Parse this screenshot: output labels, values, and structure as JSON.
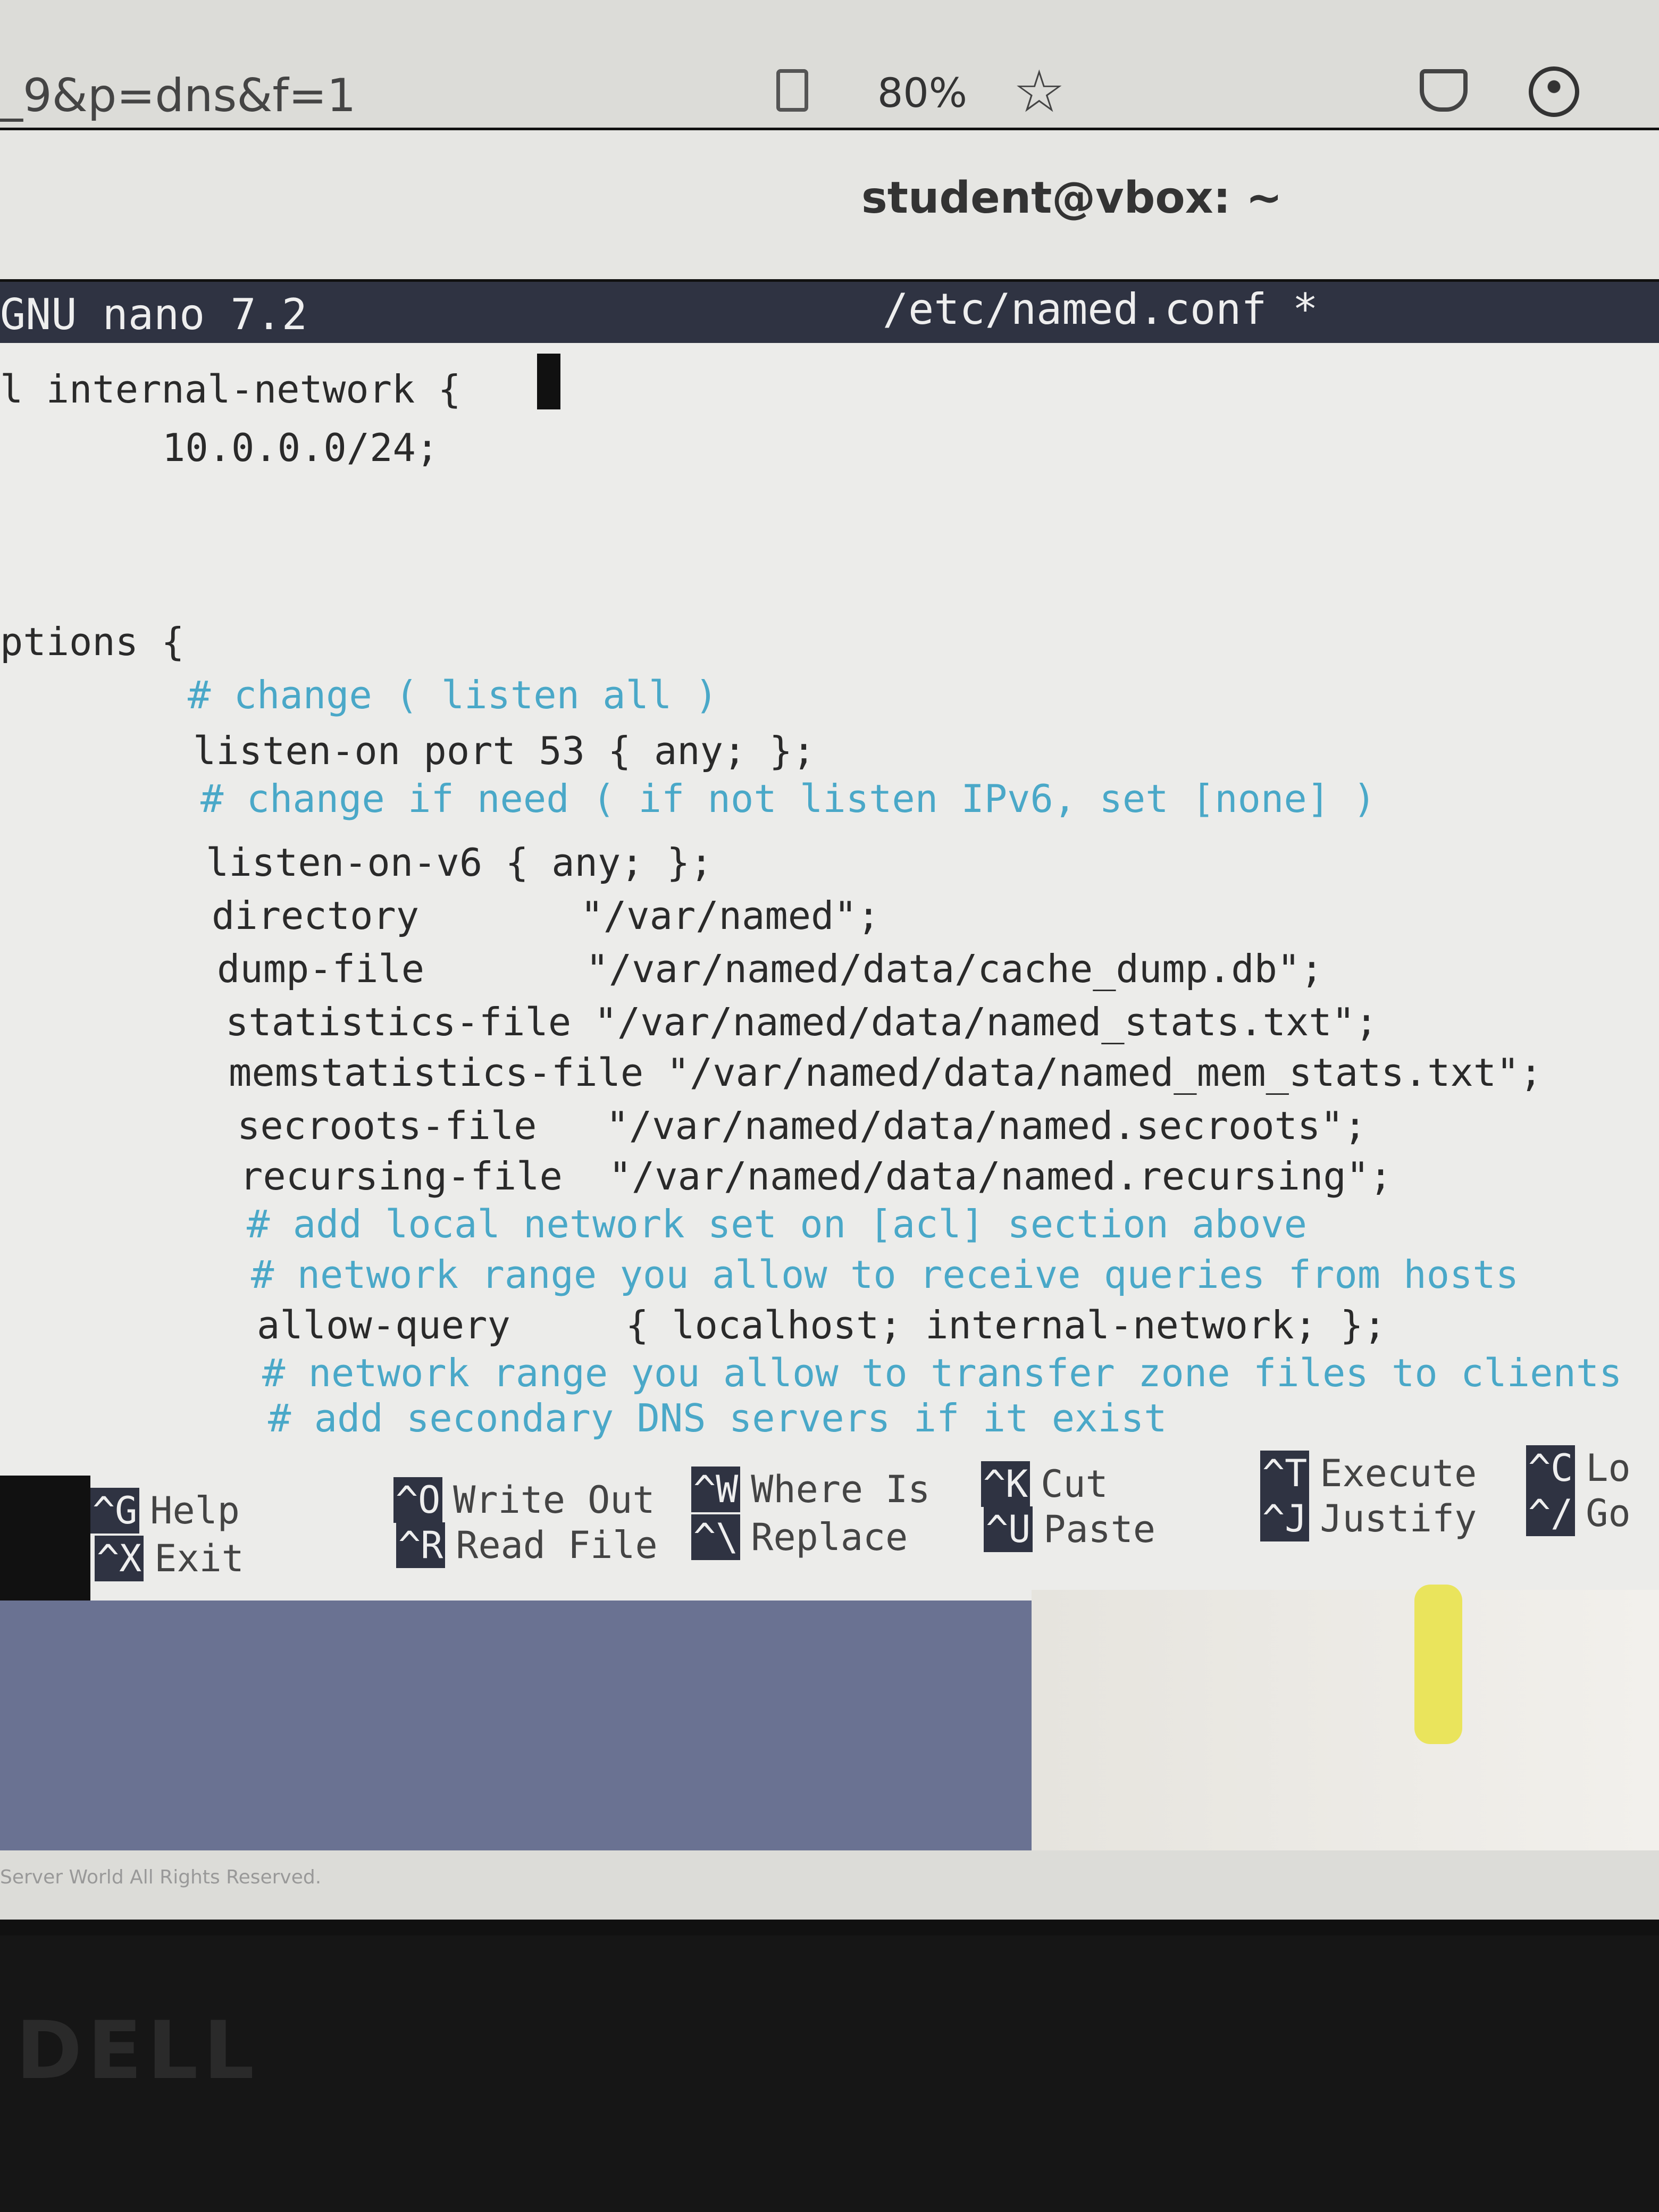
{
  "browser": {
    "url_fragment": "_9&p=dns&f=1",
    "zoom_level": "80%",
    "icons": [
      "reader-view-icon",
      "bookmark-star-icon",
      "pocket-icon",
      "account-icon"
    ]
  },
  "terminal": {
    "title": "student@vbox: ~"
  },
  "nano": {
    "version": "GNU nano 7.2",
    "filename": "/etc/named.conf *"
  },
  "editor": {
    "lines": [
      {
        "text": "l internal-network {",
        "kind": "code"
      },
      {
        "text": "10.0.0.0/24;",
        "kind": "code"
      },
      {
        "text": "ptions {",
        "kind": "code"
      },
      {
        "text": "# change ( listen all )",
        "kind": "comment"
      },
      {
        "text": "listen-on port 53 { any; };",
        "kind": "code"
      },
      {
        "text": "# change if need ( if not listen IPv6, set [none] )",
        "kind": "comment"
      },
      {
        "text": "listen-on-v6 { any; };",
        "kind": "code"
      },
      {
        "text": "directory       \"/var/named\";",
        "kind": "code"
      },
      {
        "text": "dump-file       \"/var/named/data/cache_dump.db\";",
        "kind": "code"
      },
      {
        "text": "statistics-file \"/var/named/data/named_stats.txt\";",
        "kind": "code"
      },
      {
        "text": "memstatistics-file \"/var/named/data/named_mem_stats.txt\";",
        "kind": "code"
      },
      {
        "text": "secroots-file   \"/var/named/data/named.secroots\";",
        "kind": "code"
      },
      {
        "text": "recursing-file  \"/var/named/data/named.recursing\";",
        "kind": "code"
      },
      {
        "text": "# add local network set on [acl] section above",
        "kind": "comment"
      },
      {
        "text": "# network range you allow to receive queries from hosts",
        "kind": "comment"
      },
      {
        "text": "allow-query     { localhost; internal-network; };",
        "kind": "code"
      },
      {
        "text": "# network range you allow to transfer zone files to clients",
        "kind": "comment"
      },
      {
        "text": "# add secondary DNS servers if it exist",
        "kind": "comment"
      }
    ]
  },
  "shortcuts": [
    {
      "key": "^G",
      "label": "Help"
    },
    {
      "key": "^X",
      "label": "Exit"
    },
    {
      "key": "^O",
      "label": "Write Out"
    },
    {
      "key": "^R",
      "label": "Read File"
    },
    {
      "key": "^W",
      "label": "Where Is"
    },
    {
      "key": "^\\",
      "label": "Replace"
    },
    {
      "key": "^K",
      "label": "Cut"
    },
    {
      "key": "^U",
      "label": "Paste"
    },
    {
      "key": "^T",
      "label": "Execute"
    },
    {
      "key": "^J",
      "label": "Justify"
    },
    {
      "key": "^C",
      "label": "Lo"
    },
    {
      "key": "^/",
      "label": "Go"
    }
  ],
  "footer": {
    "copyright": "Server World All Rights Reserved."
  },
  "bezel": {
    "logo": "DELL"
  },
  "colors": {
    "comment": "#4aa8c8",
    "header_bg": "#2f3342",
    "desktop": "#6a7292"
  }
}
